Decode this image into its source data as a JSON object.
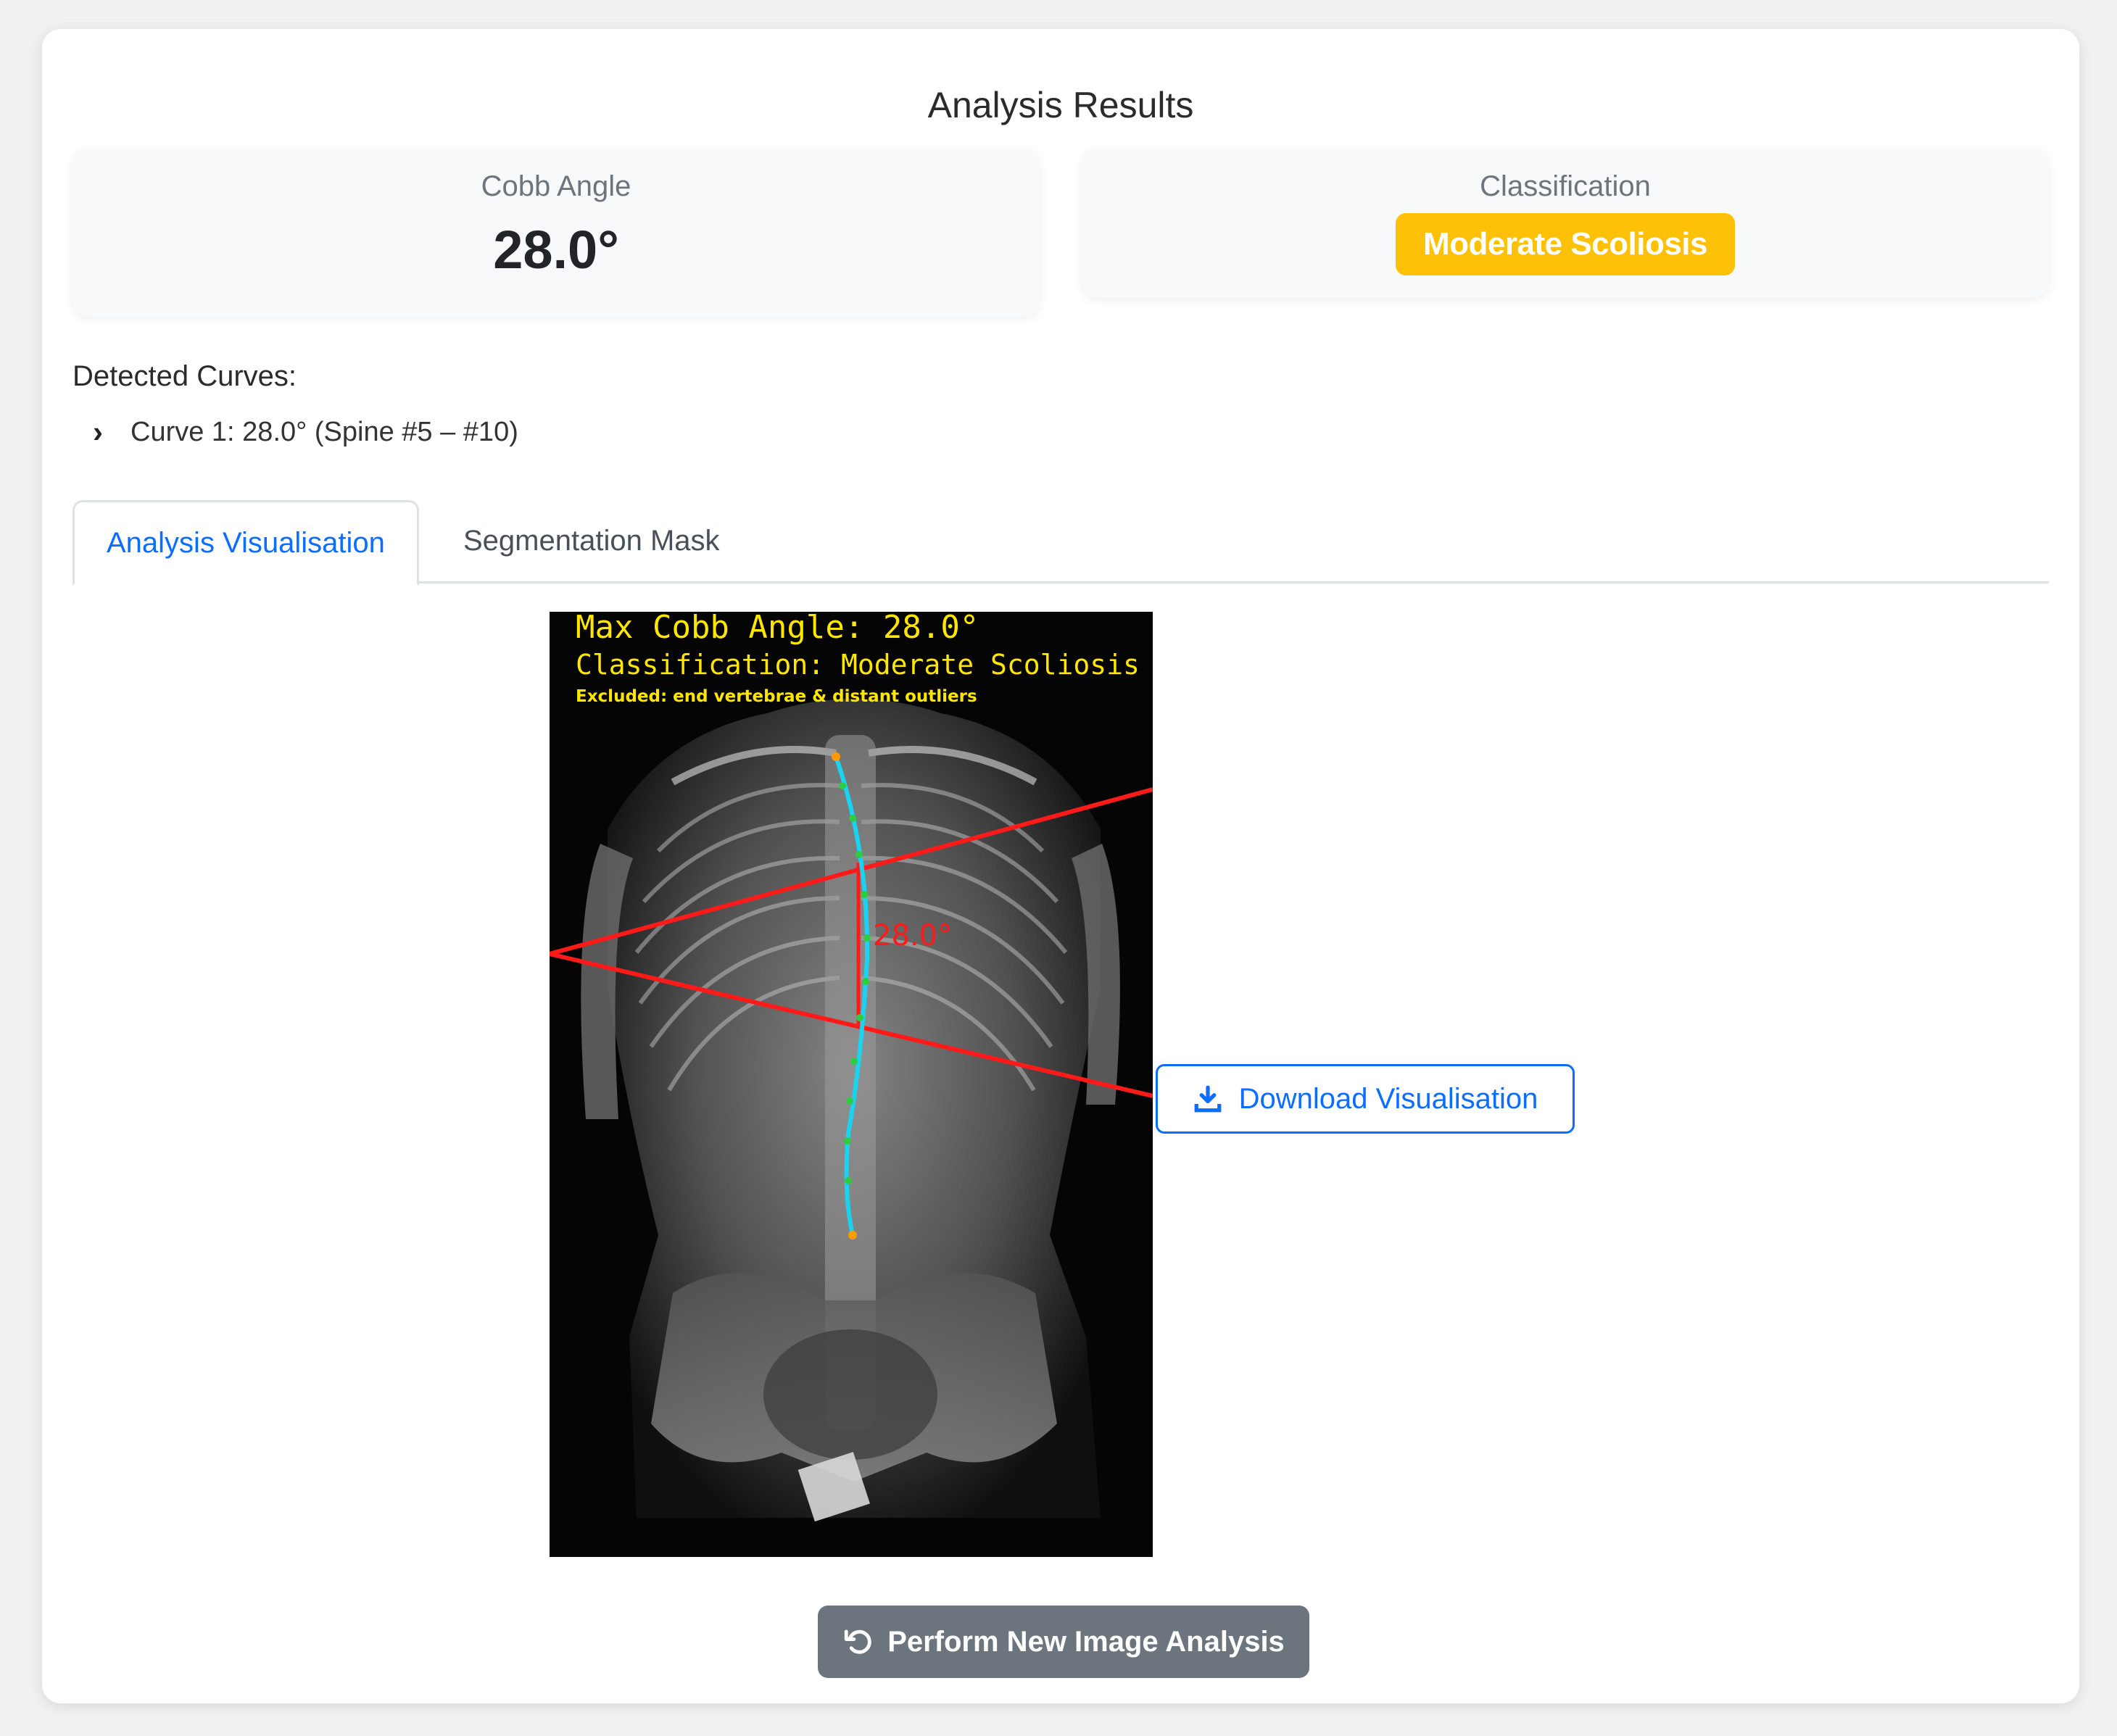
{
  "header": {
    "title": "Analysis Results"
  },
  "stats": {
    "cobb_label": "Cobb Angle",
    "cobb_value": "28.0°",
    "classification_label": "Classification",
    "classification_value": "Moderate Scoliosis",
    "badge_color": "#ffc107"
  },
  "curves": {
    "title": "Detected Curves:",
    "items": [
      {
        "label": "Curve 1: 28.0° (Spine #5 – #10)"
      }
    ]
  },
  "tabs": [
    {
      "label": "Analysis Visualisation",
      "active": true
    },
    {
      "label": "Segmentation Mask",
      "active": false
    }
  ],
  "visualisation": {
    "overlay_line1": "Max Cobb Angle: 28.0°",
    "overlay_line2": "Classification: Moderate Scoliosis",
    "overlay_line3": "Excluded: end vertebrae & distant outliers",
    "angle_label": "28.0°",
    "line_color": "#ff1a1a",
    "spine_color": "#19d3f0",
    "text_color": "#ffe600"
  },
  "actions": {
    "download_label": "Download Visualisation",
    "new_analysis_label": "Perform New Image Analysis"
  },
  "colors": {
    "primary": "#0d6efd",
    "secondary": "#6c757d"
  }
}
